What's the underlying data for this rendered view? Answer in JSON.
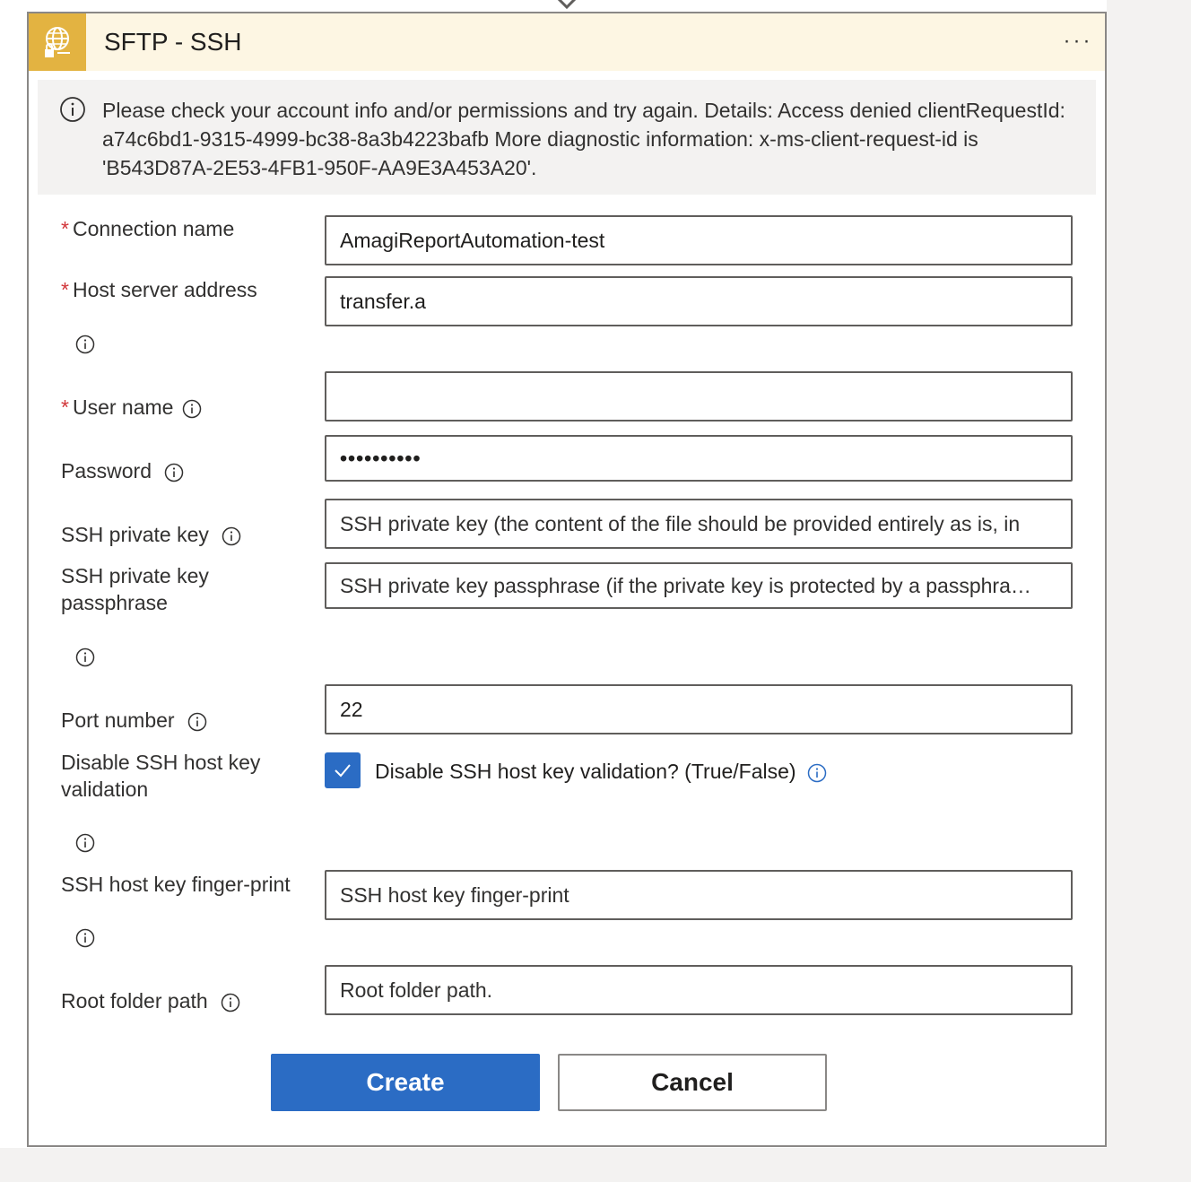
{
  "card": {
    "title": "SFTP - SSH",
    "more_label": "···",
    "icon": "globe-lock-icon"
  },
  "error": {
    "message": "Please check your account info and/or permissions and try again. Details: Access denied clientRequestId: a74c6bd1-9315-4999-bc38-8a3b4223bafb More diagnostic information: x-ms-client-request-id is 'B543D87A-2E53-4FB1-950F-AA9E3A453A20'."
  },
  "fields": {
    "connection_name": {
      "label": "Connection name",
      "required": "*",
      "value": "AmagiReportAutomation-test"
    },
    "host_server": {
      "label": "Host server address",
      "required": "*",
      "value": "transfer.a"
    },
    "user_name": {
      "label": "User name",
      "required": "*",
      "value": ""
    },
    "password": {
      "label": "Password",
      "value": "••••••••••"
    },
    "ssh_private_key": {
      "label": "SSH private key",
      "placeholder": "SSH private key (the content of the file should be provided entirely as is, in"
    },
    "ssh_passphrase": {
      "label_line1": "SSH private key",
      "label_line2": "passphrase",
      "placeholder": "SSH private key passphrase (if the private key is protected by a passphra…"
    },
    "port": {
      "label": "Port number",
      "value": "22"
    },
    "disable_validation": {
      "label_line1": "Disable SSH host key",
      "label_line2": "validation",
      "checkbox_label": "Disable SSH host key validation? (True/False)",
      "checked": true
    },
    "fingerprint": {
      "label": "SSH host key finger-print",
      "placeholder": "SSH host key finger-print"
    },
    "root_folder": {
      "label": "Root folder path",
      "placeholder": "Root folder path."
    }
  },
  "buttons": {
    "create": "Create",
    "cancel": "Cancel"
  },
  "colors": {
    "accent": "#2b6cc4",
    "header_bg": "#fdf6e3",
    "icon_bg": "#e3b341",
    "required": "#d13438"
  }
}
